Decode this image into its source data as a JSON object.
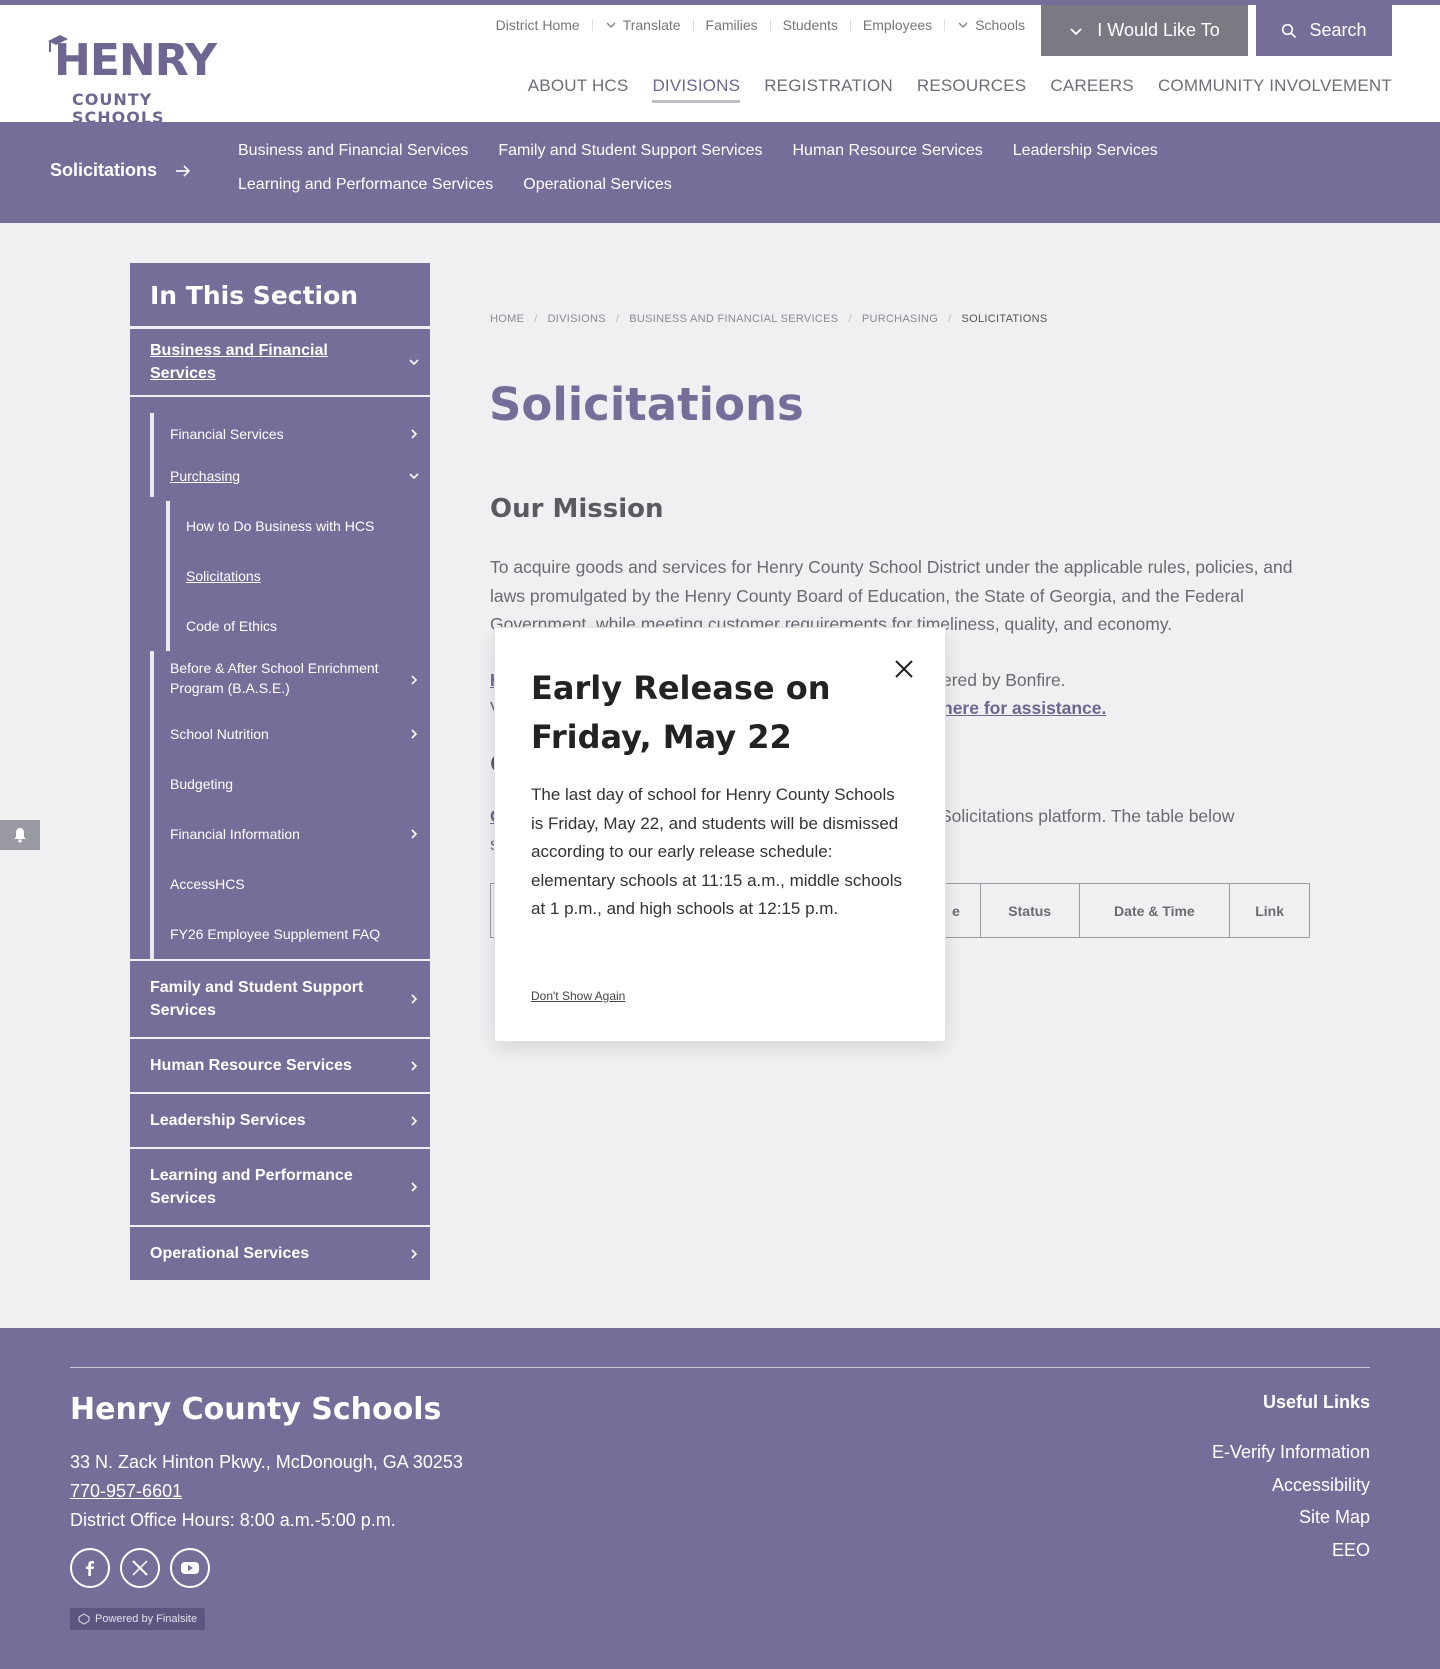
{
  "header": {
    "logo_line1": "HENRY",
    "logo_line2": "COUNTY SCHOOLS",
    "utility": [
      "District Home",
      "Translate",
      "Families",
      "Students",
      "Employees",
      "Schools"
    ],
    "would_like_label": "I Would Like To",
    "search_label": "Search",
    "nav": [
      "ABOUT HCS",
      "DIVISIONS",
      "REGISTRATION",
      "RESOURCES",
      "CAREERS",
      "COMMUNITY INVOLVEMENT"
    ],
    "nav_active": "DIVISIONS"
  },
  "subnav": {
    "title": "Solicitations",
    "links": [
      "Business and Financial Services",
      "Family and Student Support Services",
      "Human Resource Services",
      "Leadership Services",
      "Learning and Performance Services",
      "Operational Services"
    ]
  },
  "sidebar": {
    "heading": "In This Section",
    "top": "Business and Financial Services",
    "level2": [
      "Financial Services",
      "Purchasing"
    ],
    "level3": [
      "How to Do Business with HCS",
      "Solicitations",
      "Code of Ethics"
    ],
    "level2b": [
      "Before & After School Enrichment Program (B.A.S.E.)",
      "School Nutrition",
      "Budgeting",
      "Financial Information",
      "AccessHCS",
      "FY26 Employee Supplement FAQ"
    ],
    "sections": [
      "Family and Student Support Services",
      "Human Resource Services",
      "Leadership Services",
      "Learning and Performance Services",
      "Operational Services"
    ]
  },
  "breadcrumb": [
    "HOME",
    "DIVISIONS",
    "BUSINESS AND FINANCIAL SERVICES",
    "PURCHASING",
    "SOLICITATIONS"
  ],
  "page": {
    "title": "Solicitations",
    "mission_heading": "Our Mission",
    "mission_text": "To acquire goods and services for Henry County School District under the applicable rules, policies, and laws promulgated by the Henry County Board of Education, the State of Georgia, and the Federal Government, while meeting customer requirements for timeliness, quality, and economy.",
    "bonfire_frag_left": "H",
    "bonfire_frag_right": "ered by Bonfire.",
    "bonfire_frag_left2": "V",
    "help_link": "here for assistance.",
    "section_frag": "C",
    "sol_frag_left": "C",
    "sol_frag_right": "Solicitations platform. The table below",
    "sol_frag_left2": "s",
    "table_headers": [
      "e",
      "Status",
      "Date & Time",
      "Link"
    ]
  },
  "modal": {
    "title": "Early Release on Friday, May 22",
    "body": "The last day of school for Henry County Schools is Friday, May 22, and students will be dismissed according to our early release schedule: elementary schools at 11:15 a.m., middle schools at 1 p.m., and high schools at 12:15 p.m.",
    "dont_show": "Don't Show Again"
  },
  "footer": {
    "name": "Henry County Schools",
    "address": "33 N. Zack Hinton Pkwy., McDonough, GA  30253",
    "phone": "770-957-6601",
    "hours": "District Office Hours: 8:00 a.m.-5:00 p.m.",
    "useful_heading": "Useful Links",
    "useful_links": [
      "E-Verify Information",
      "Accessibility",
      "Site Map",
      "EEO"
    ],
    "powered": "Powered by Finalsite"
  }
}
